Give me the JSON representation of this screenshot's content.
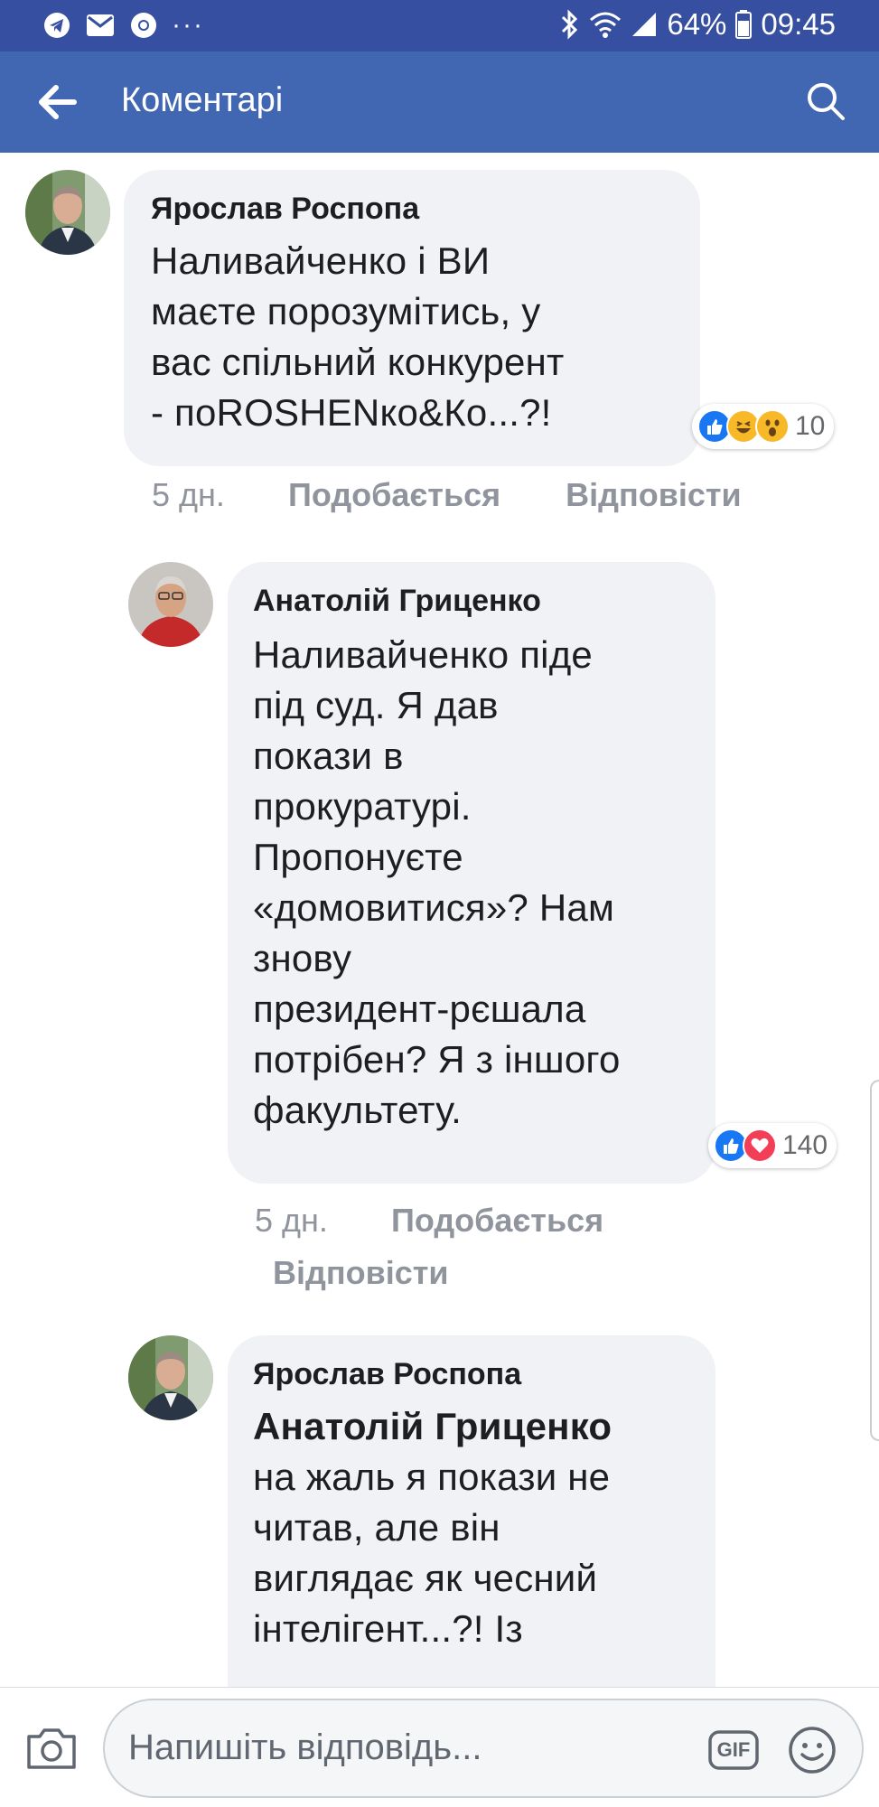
{
  "status_bar": {
    "dots": "···",
    "battery": "64%",
    "time": "09:45",
    "icons": [
      "telegram-icon",
      "mail-icon",
      "chrome-icon",
      "bluetooth-icon",
      "wifi-icon",
      "signal-icon",
      "battery-icon"
    ]
  },
  "header": {
    "title": "Коментарі",
    "back_icon": "arrow-left-icon",
    "search_icon": "search-icon",
    "background": "#4267b2",
    "status_background": "#364fa1"
  },
  "comments": [
    {
      "author": "Ярослав Роспопа",
      "lines": [
        "Наливайченко і ВИ",
        "маєте порозумітись, у",
        "вас спільний конкурент",
        "- поROSHENко&Ко...?!"
      ],
      "reactions": [
        "like",
        "haha",
        "wow"
      ],
      "reaction_count": "10",
      "time": "5 дн.",
      "like_label": "Подобається",
      "reply_label": "Відповісти"
    },
    {
      "author": "Анатолій Гриценко",
      "lines": [
        "Наливайченко піде",
        "під суд. Я дав",
        "покази в",
        "прокуратурі.",
        "Пропонуєте",
        "«домовитися»? Нам",
        "знову",
        "президент-рєшала",
        "потрібен? Я з іншого",
        "факультету."
      ],
      "reactions": [
        "like",
        "love"
      ],
      "reaction_count": "140",
      "time": "5 дн.",
      "like_label": "Подобається",
      "reply_label": "Відповісти"
    },
    {
      "author": "Ярослав Роспопа",
      "mention": "Анатолій Гриценко",
      "lines": [
        "на жаль я покази не",
        "читав, але він",
        "виглядає як чесний",
        "інтелігент...?! Із"
      ]
    }
  ],
  "composer": {
    "placeholder": "Напишіть відповідь...",
    "camera_icon": "camera-icon",
    "gif_label": "GIF",
    "emoji_icon": "smiley-icon"
  },
  "colors": {
    "like": "#1877f2",
    "haha": "#f7b928",
    "love": "#f33e58",
    "bubble": "#f0f2f5",
    "meta": "#90949c"
  }
}
